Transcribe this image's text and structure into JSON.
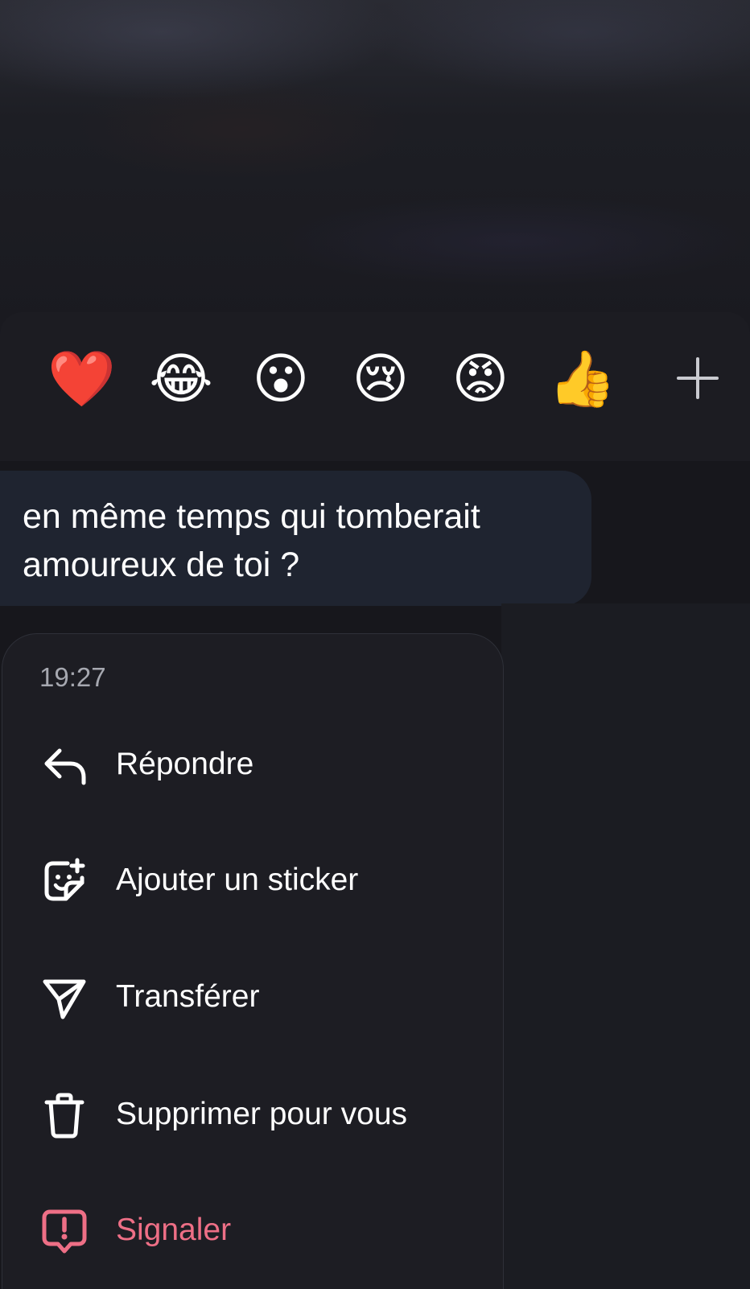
{
  "reactions": {
    "emojis": [
      {
        "name": "red-heart",
        "glyph": "❤️"
      },
      {
        "name": "face-with-tears-of-joy",
        "glyph": "😂"
      },
      {
        "name": "face-with-open-mouth",
        "glyph": "😮"
      },
      {
        "name": "crying-face",
        "glyph": "😢"
      },
      {
        "name": "angry-face",
        "glyph": "😡"
      },
      {
        "name": "thumbs-up",
        "glyph": "👍"
      }
    ],
    "more_icon": "plus-icon"
  },
  "message": {
    "text": "en même temps qui tomberait\namoureux de toi ?"
  },
  "menu": {
    "timestamp": "19:27",
    "items": [
      {
        "label": "Répondre",
        "icon": "reply-icon"
      },
      {
        "label": "Ajouter un sticker",
        "icon": "sticker-icon"
      },
      {
        "label": "Transférer",
        "icon": "send-icon"
      },
      {
        "label": "Supprimer pour vous",
        "icon": "trash-icon"
      },
      {
        "label": "Signaler",
        "icon": "report-icon"
      }
    ]
  },
  "colors": {
    "background": "#17171c",
    "bubble": "#1f2430",
    "menu": "#1d1d23",
    "danger": "#ee6f86",
    "muted_text": "#a6a8b0"
  }
}
